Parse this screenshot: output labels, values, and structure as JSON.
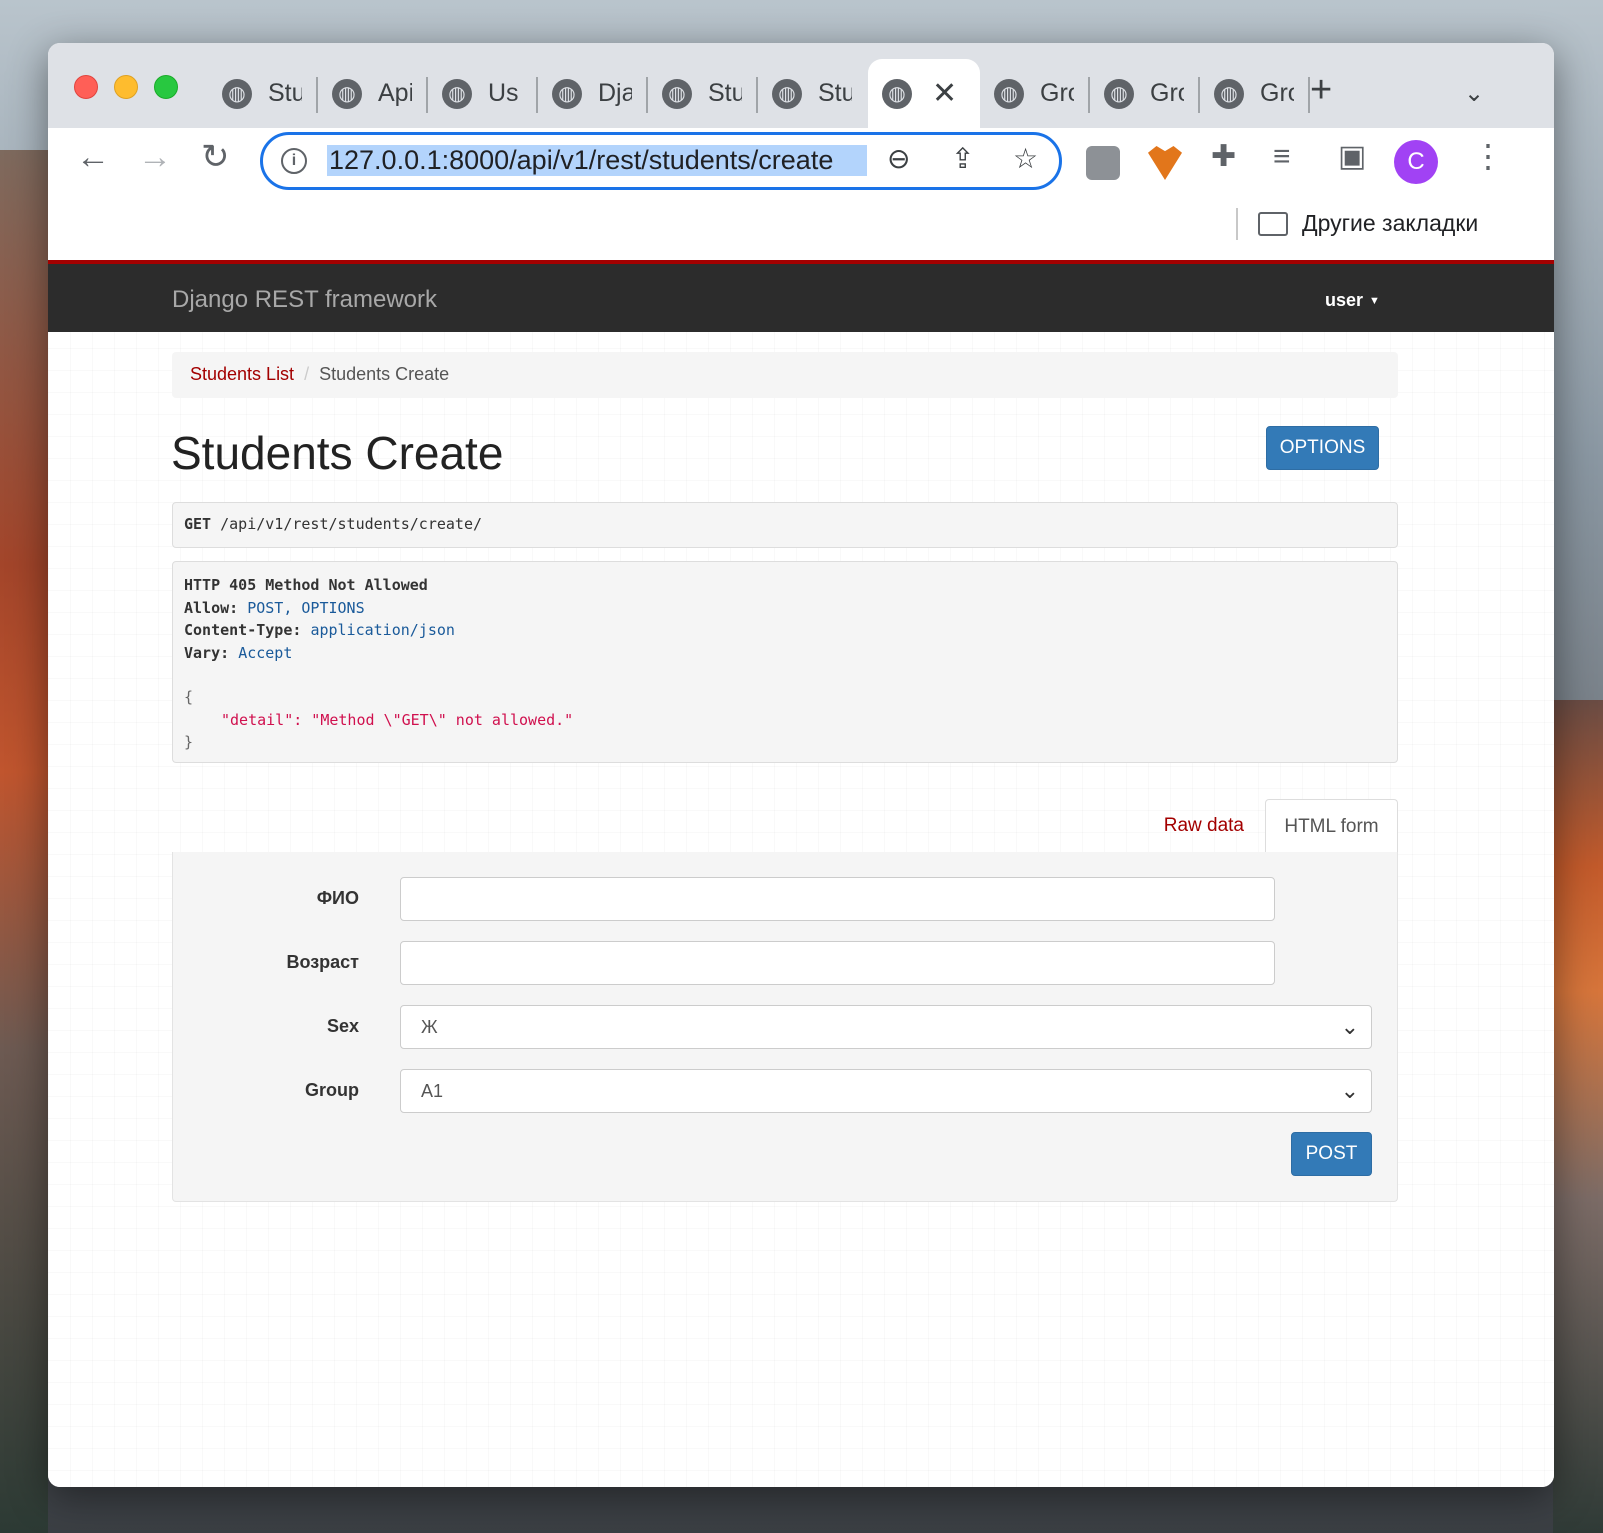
{
  "browser": {
    "tabs": [
      {
        "title": "Stu",
        "active": false
      },
      {
        "title": "Api",
        "active": false
      },
      {
        "title": "Us",
        "active": false
      },
      {
        "title": "Dja",
        "active": false
      },
      {
        "title": "Stu",
        "active": false
      },
      {
        "title": "Stu",
        "active": false
      },
      {
        "title": "",
        "active": true
      },
      {
        "title": "Gro",
        "active": false
      },
      {
        "title": "Gro",
        "active": false
      },
      {
        "title": "Gro",
        "active": false
      }
    ],
    "url": "127.0.0.1:8000/api/v1/rest/students/create",
    "profile_initial": "C",
    "bookmarks_folder": "Другие закладки"
  },
  "navbar": {
    "brand": "Django REST framework",
    "user": "user",
    "accent_color": "#a30000"
  },
  "breadcrumb": {
    "parent": "Students List",
    "current": "Students Create"
  },
  "page": {
    "title": "Students Create",
    "options_label": "OPTIONS"
  },
  "request": {
    "method": "GET",
    "path": "/api/v1/rest/students/create/"
  },
  "response": {
    "status_line": "HTTP 405 Method Not Allowed",
    "headers": [
      {
        "key": "Allow:",
        "value": "POST, OPTIONS"
      },
      {
        "key": "Content-Type:",
        "value": "application/json"
      },
      {
        "key": "Vary:",
        "value": "Accept"
      }
    ],
    "open_brace": "{",
    "body_line": "\"detail\": \"Method \\\"GET\\\" not allowed.\"",
    "close_brace": "}"
  },
  "form_tabs": {
    "raw": "Raw data",
    "html": "HTML form"
  },
  "form": {
    "fields": [
      {
        "label": "ФИО",
        "value": ""
      },
      {
        "label": "Возраст",
        "value": ""
      },
      {
        "label": "Sex",
        "value": "Ж"
      },
      {
        "label": "Group",
        "value": "A1"
      }
    ],
    "submit": "POST"
  }
}
